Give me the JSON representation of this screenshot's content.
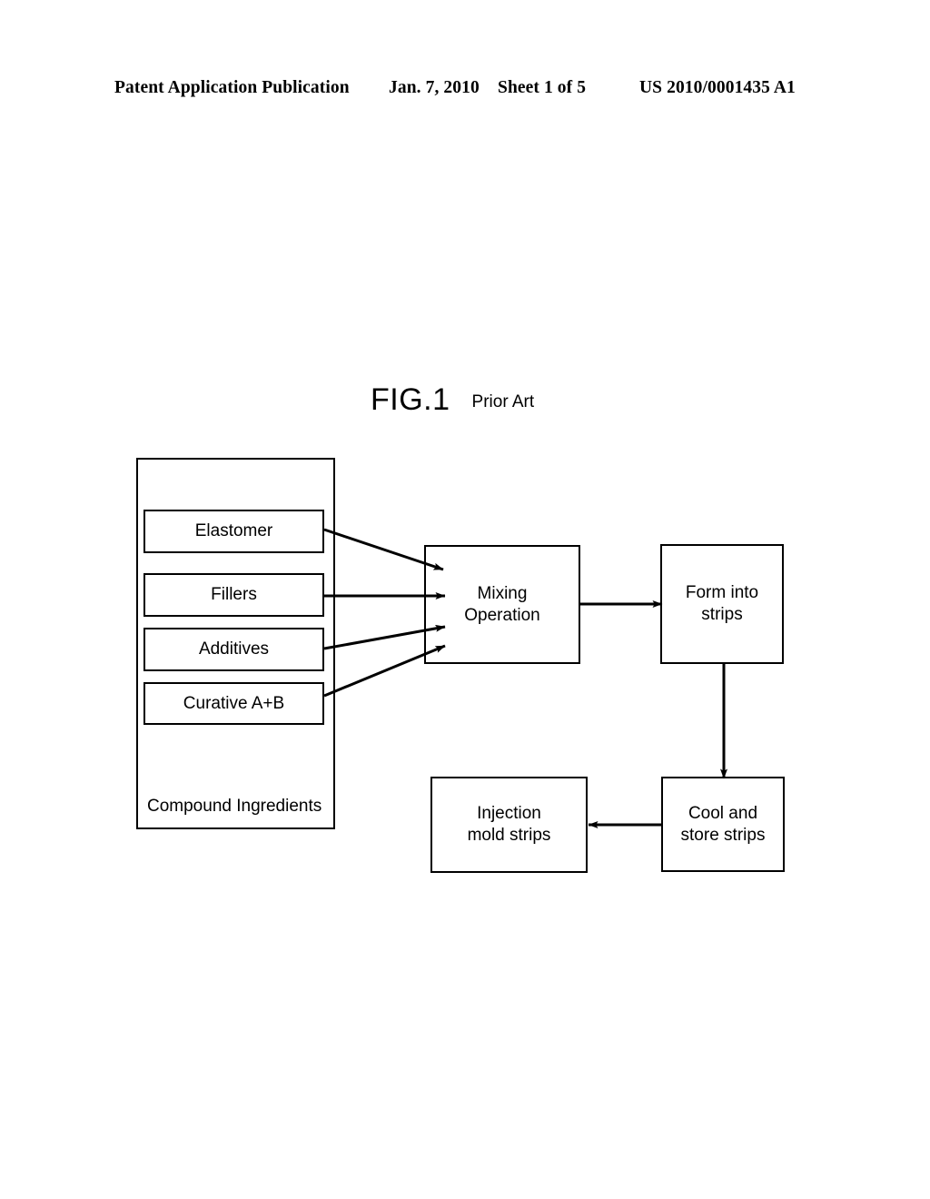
{
  "header": {
    "publication": "Patent Application Publication",
    "date": "Jan. 7, 2010",
    "sheet": "Sheet 1 of 5",
    "number": "US 2010/0001435 A1"
  },
  "figure": {
    "label": "FIG.1",
    "sublabel": "Prior Art"
  },
  "diagram": {
    "container": {
      "label": "Compound Ingredients",
      "ingredients": [
        {
          "label": "Elastomer"
        },
        {
          "label": "Fillers"
        },
        {
          "label": "Additives"
        },
        {
          "label": "Curative A+B"
        }
      ]
    },
    "process_nodes": [
      {
        "label": "Mixing\nOperation"
      },
      {
        "label": "Form into\nstrips"
      },
      {
        "label": "Injection\nmold strips"
      },
      {
        "label": "Cool and\nstore strips"
      }
    ],
    "mixing_line_1": "Mixing",
    "mixing_line_2": "Operation",
    "form_line_1": "Form into",
    "form_line_2": "strips",
    "injection_line_1": "Injection",
    "injection_line_2": "mold strips",
    "cool_line_1": "Cool and",
    "cool_line_2": "store strips",
    "edges": [
      {
        "from": "Elastomer",
        "to": "Mixing Operation"
      },
      {
        "from": "Fillers",
        "to": "Mixing Operation"
      },
      {
        "from": "Additives",
        "to": "Mixing Operation"
      },
      {
        "from": "Curative A+B",
        "to": "Mixing Operation"
      },
      {
        "from": "Mixing Operation",
        "to": "Form into strips"
      },
      {
        "from": "Form into strips",
        "to": "Cool and store strips"
      },
      {
        "from": "Cool and store strips",
        "to": "Injection mold strips"
      }
    ],
    "colors": {
      "stroke": "#000000",
      "fill": "#ffffff"
    }
  }
}
